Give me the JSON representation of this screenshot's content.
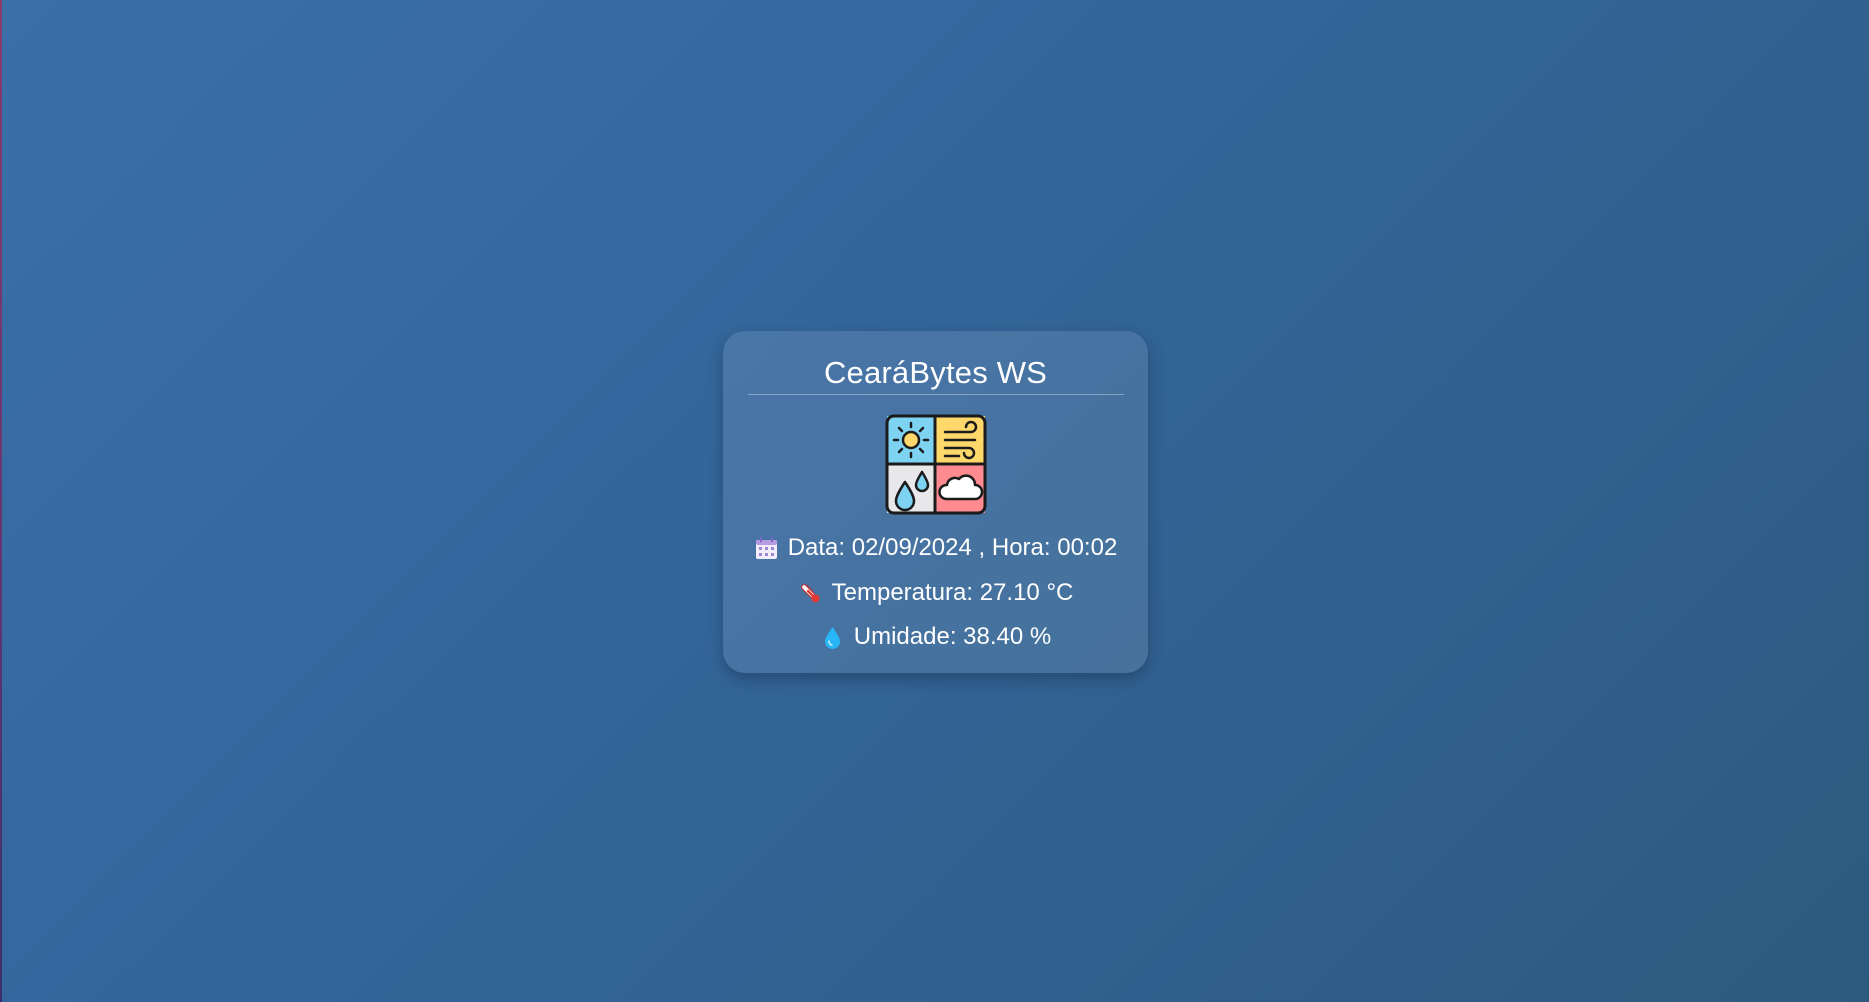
{
  "station": {
    "title": "CearáBytes WS"
  },
  "readings": {
    "date_label": "Data:",
    "date_value": "02/09/2024",
    "separator": ",",
    "time_label": "Hora:",
    "time_value": "00:02",
    "temperature_label": "Temperatura:",
    "temperature_value": "27.10",
    "temperature_unit": "°C",
    "humidity_label": "Umidade:",
    "humidity_value": "38.40",
    "humidity_unit": "%"
  },
  "icons": {
    "logo": "weather-tiles-icon",
    "date": "calendar-icon",
    "temperature": "thermometer-icon",
    "humidity": "water-drop-icon"
  },
  "colors": {
    "sun_tile": "#7fd3f2",
    "wind_tile": "#ffd86b",
    "rain_tile": "#e8e8ea",
    "cloud_tile": "#ff8a8f",
    "drop": "#29b6f6",
    "thermo": "#e53935"
  }
}
